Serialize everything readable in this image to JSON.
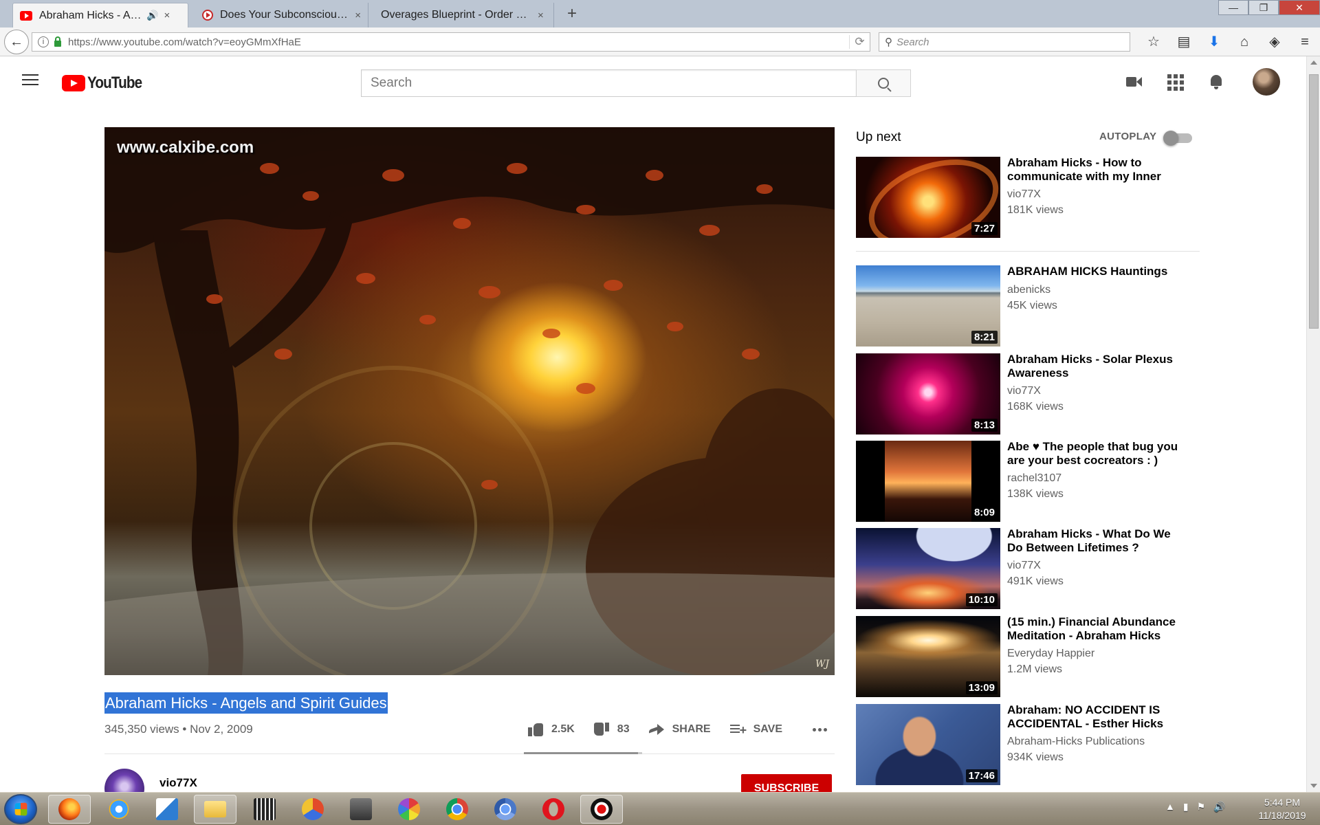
{
  "browser": {
    "tabs": [
      {
        "title": "Abraham Hicks - Angels and Spirit Guides - YouTube",
        "active": true,
        "audio": true
      },
      {
        "title": "Does Your Subconscious Mind Block Your Success",
        "active": false,
        "audio": false
      },
      {
        "title": "Overages Blueprint - Order Now",
        "active": false,
        "audio": false
      }
    ],
    "new_tab_glyph": "+",
    "tab_close_glyph": "×",
    "audio_glyph": "🔊",
    "url": "https://www.youtube.com/watch?v=eoyGMmXfHaE",
    "info_glyph": "i",
    "reload_glyph": "⟳",
    "back_glyph": "←",
    "search_placeholder": "Search",
    "search_glyph": "⚲",
    "window_controls": {
      "minimize": "—",
      "maximize": "❐",
      "close": "✕"
    },
    "toolbar": {
      "bookmark": "☆",
      "reader": "▤",
      "download": "⬇",
      "home": "⌂",
      "pocket": "◈",
      "menu": "≡"
    }
  },
  "youtube": {
    "logo_text": "YouTube",
    "search_placeholder": "Search",
    "video": {
      "watermark": "www.calxibe.com",
      "signature": "WJ",
      "title": "Abraham Hicks - Angels and Spirit Guides",
      "meta": "345,350 views • Nov 2, 2009",
      "likes": "2.5K",
      "dislikes": "83",
      "like_ratio": 0.968,
      "share_label": "SHARE",
      "save_label": "SAVE",
      "channel": "vio77X",
      "subscribe_label": "SUBSCRIBE"
    },
    "up_next_label": "Up next",
    "autoplay_label": "AUTOPLAY",
    "autoplay_on": false,
    "recommendations": [
      {
        "title": "Abraham Hicks - How to communicate with my Inner",
        "channel": "vio77X",
        "views": "181K views",
        "duration": "7:27"
      },
      {
        "title": "ABRAHAM HICKS Hauntings",
        "channel": "abenicks",
        "views": "45K views",
        "duration": "8:21"
      },
      {
        "title": "Abraham Hicks - Solar Plexus Awareness",
        "channel": "vio77X",
        "views": "168K views",
        "duration": "8:13"
      },
      {
        "title": "Abe ♥ The people that bug you are your best cocreators : )",
        "channel": "rachel3107",
        "views": "138K views",
        "duration": "8:09"
      },
      {
        "title": "Abraham Hicks - What Do We Do Between Lifetimes ?",
        "channel": "vio77X",
        "views": "491K views",
        "duration": "10:10"
      },
      {
        "title": "(15 min.) Financial Abundance Meditation - Abraham Hicks",
        "channel": "Everyday Happier",
        "views": "1.2M views",
        "duration": "13:09"
      },
      {
        "title": "Abraham: NO ACCIDENT IS ACCIDENTAL - Esther Hicks",
        "channel": "Abraham-Hicks Publications",
        "views": "934K views",
        "duration": "17:46"
      }
    ]
  },
  "taskbar": {
    "tray_glyphs": {
      "show_hidden": "▲",
      "network": "▮",
      "flag": "⚑",
      "volume": "🔊"
    },
    "time": "5:44 PM",
    "date": "11/18/2019"
  }
}
